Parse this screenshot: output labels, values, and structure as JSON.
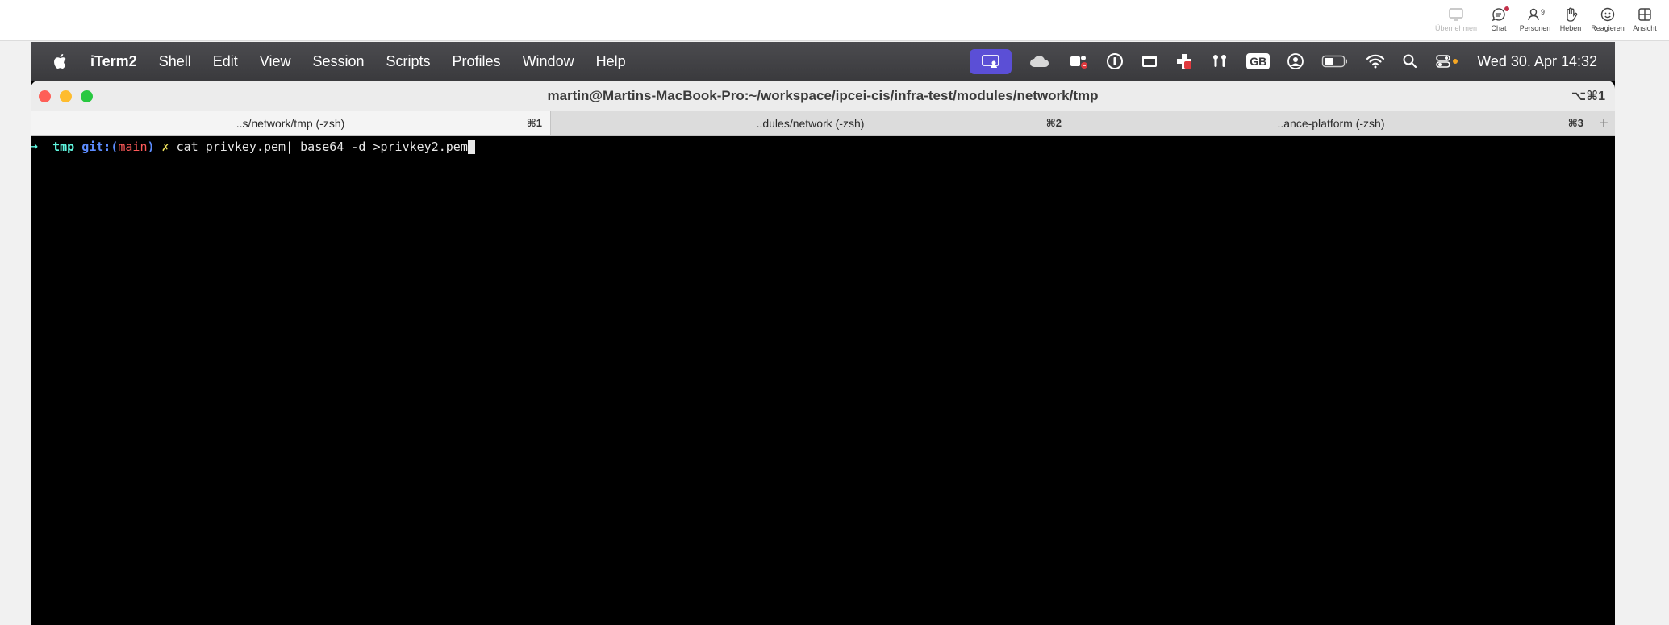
{
  "teams_toolbar": {
    "items": [
      {
        "label": "Übernehmen",
        "icon": "share-screen-icon"
      },
      {
        "label": "Chat",
        "icon": "chat-icon"
      },
      {
        "label": "Personen",
        "icon": "people-icon",
        "count": "9"
      },
      {
        "label": "Heben",
        "icon": "raise-hand-icon"
      },
      {
        "label": "Reagieren",
        "icon": "smiley-icon"
      },
      {
        "label": "Ansicht",
        "icon": "grid-view-icon"
      }
    ]
  },
  "menubar": {
    "app_name": "iTerm2",
    "items": [
      "Shell",
      "Edit",
      "View",
      "Session",
      "Scripts",
      "Profiles",
      "Window",
      "Help"
    ],
    "keyboard_layout": "GB",
    "clock": "Wed 30. Apr  14:32"
  },
  "window": {
    "title": "martin@Martins-MacBook-Pro:~/workspace/ipcei-cis/infra-test/modules/network/tmp",
    "shortcut": "⌥⌘1",
    "tabs": [
      {
        "label": "..s/network/tmp (-zsh)",
        "shortcut": "⌘1"
      },
      {
        "label": "..dules/network (-zsh)",
        "shortcut": "⌘2"
      },
      {
        "label": "..ance-platform (-zsh)",
        "shortcut": "⌘3"
      }
    ],
    "add_tab": "+"
  },
  "terminal": {
    "prompt_arrow": "➜",
    "directory": "tmp",
    "git_label": "git:(",
    "branch": "main",
    "git_close": ")",
    "dirty_marker": "✗",
    "command": "cat privkey.pem| base64 -d >privkey2.pem"
  },
  "colors": {
    "accent_purple": "#5b4fd6",
    "prompt_cyan": "#5ff7e0",
    "git_blue": "#5c8cff",
    "branch_red": "#ff5a5a",
    "dirty_yellow": "#f4e65d"
  }
}
